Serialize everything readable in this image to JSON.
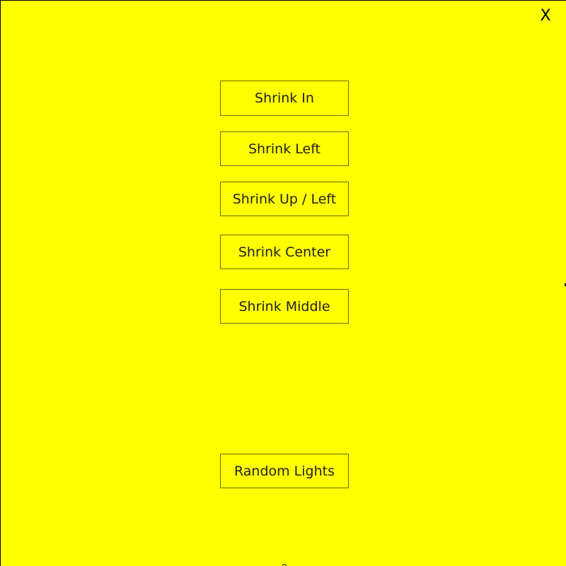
{
  "window": {
    "close_label": "X",
    "background_color": "#ffff00"
  },
  "menu": {
    "buttons": [
      {
        "label": "Shrink In"
      },
      {
        "label": "Shrink Left"
      },
      {
        "label": "Shrink Up / Left"
      },
      {
        "label": "Shrink Center"
      },
      {
        "label": "Shrink Middle"
      },
      {
        "label": "Random Lights"
      }
    ]
  }
}
